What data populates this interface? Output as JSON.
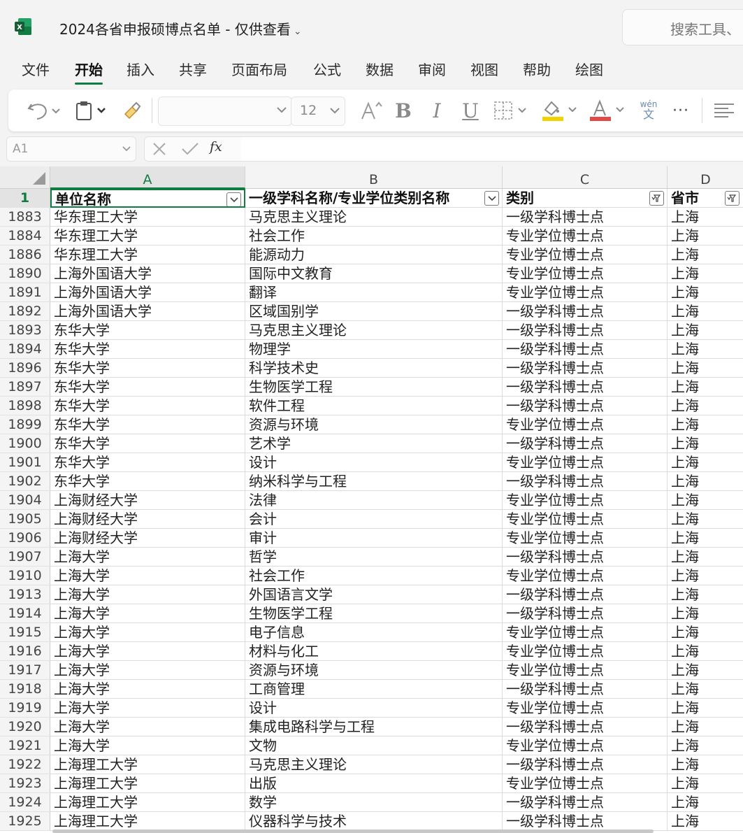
{
  "app": {
    "title": "2024各省申报硕博点名单 - 仅供查看",
    "title_chevron": "⌄",
    "search_placeholder": "搜索工具、"
  },
  "tabs": [
    "文件",
    "开始",
    "插入",
    "共享",
    "页面布局",
    "公式",
    "数据",
    "审阅",
    "视图",
    "帮助",
    "绘图"
  ],
  "active_tab": "开始",
  "ribbon": {
    "font_name": "",
    "font_size": "12",
    "wen_label": "wén",
    "wen_char": "文",
    "more_label": "···"
  },
  "formula_bar": {
    "name_box": "A1",
    "fx_label": "fx",
    "formula": ""
  },
  "sheet": {
    "columns": [
      "A",
      "B",
      "C",
      "D"
    ],
    "header_row": {
      "row_number": "1",
      "cells": [
        "单位名称",
        "一级学科名称/专业学位类别名称",
        "类别",
        "省市"
      ]
    },
    "rows": [
      {
        "n": "1883",
        "c": [
          "华东理工大学",
          "马克思主义理论",
          "一级学科博士点",
          "上海"
        ]
      },
      {
        "n": "1884",
        "c": [
          "华东理工大学",
          "社会工作",
          "专业学位博士点",
          "上海"
        ]
      },
      {
        "n": "1886",
        "c": [
          "华东理工大学",
          "能源动力",
          "专业学位博士点",
          "上海"
        ]
      },
      {
        "n": "1890",
        "c": [
          "上海外国语大学",
          "国际中文教育",
          "专业学位博士点",
          "上海"
        ]
      },
      {
        "n": "1891",
        "c": [
          "上海外国语大学",
          "翻译",
          "专业学位博士点",
          "上海"
        ]
      },
      {
        "n": "1892",
        "c": [
          "上海外国语大学",
          "区域国别学",
          "一级学科博士点",
          "上海"
        ]
      },
      {
        "n": "1893",
        "c": [
          "东华大学",
          "马克思主义理论",
          "一级学科博士点",
          "上海"
        ]
      },
      {
        "n": "1894",
        "c": [
          "东华大学",
          "物理学",
          "一级学科博士点",
          "上海"
        ]
      },
      {
        "n": "1896",
        "c": [
          "东华大学",
          "科学技术史",
          "一级学科博士点",
          "上海"
        ]
      },
      {
        "n": "1897",
        "c": [
          "东华大学",
          "生物医学工程",
          "一级学科博士点",
          "上海"
        ]
      },
      {
        "n": "1898",
        "c": [
          "东华大学",
          "软件工程",
          "一级学科博士点",
          "上海"
        ]
      },
      {
        "n": "1899",
        "c": [
          "东华大学",
          "资源与环境",
          "专业学位博士点",
          "上海"
        ]
      },
      {
        "n": "1900",
        "c": [
          "东华大学",
          "艺术学",
          "一级学科博士点",
          "上海"
        ]
      },
      {
        "n": "1901",
        "c": [
          "东华大学",
          "设计",
          "专业学位博士点",
          "上海"
        ]
      },
      {
        "n": "1902",
        "c": [
          "东华大学",
          "纳米科学与工程",
          "一级学科博士点",
          "上海"
        ]
      },
      {
        "n": "1904",
        "c": [
          "上海财经大学",
          "法律",
          "专业学位博士点",
          "上海"
        ]
      },
      {
        "n": "1905",
        "c": [
          "上海财经大学",
          "会计",
          "专业学位博士点",
          "上海"
        ]
      },
      {
        "n": "1906",
        "c": [
          "上海财经大学",
          "审计",
          "专业学位博士点",
          "上海"
        ]
      },
      {
        "n": "1907",
        "c": [
          "上海大学",
          "哲学",
          "一级学科博士点",
          "上海"
        ]
      },
      {
        "n": "1910",
        "c": [
          "上海大学",
          "社会工作",
          "专业学位博士点",
          "上海"
        ]
      },
      {
        "n": "1913",
        "c": [
          "上海大学",
          "外国语言文学",
          "一级学科博士点",
          "上海"
        ]
      },
      {
        "n": "1914",
        "c": [
          "上海大学",
          "生物医学工程",
          "一级学科博士点",
          "上海"
        ]
      },
      {
        "n": "1915",
        "c": [
          "上海大学",
          "电子信息",
          "专业学位博士点",
          "上海"
        ]
      },
      {
        "n": "1916",
        "c": [
          "上海大学",
          "材料与化工",
          "专业学位博士点",
          "上海"
        ]
      },
      {
        "n": "1917",
        "c": [
          "上海大学",
          "资源与环境",
          "专业学位博士点",
          "上海"
        ]
      },
      {
        "n": "1918",
        "c": [
          "上海大学",
          "工商管理",
          "一级学科博士点",
          "上海"
        ]
      },
      {
        "n": "1919",
        "c": [
          "上海大学",
          "设计",
          "专业学位博士点",
          "上海"
        ]
      },
      {
        "n": "1920",
        "c": [
          "上海大学",
          "集成电路科学与工程",
          "一级学科博士点",
          "上海"
        ]
      },
      {
        "n": "1921",
        "c": [
          "上海大学",
          "文物",
          "专业学位博士点",
          "上海"
        ]
      },
      {
        "n": "1922",
        "c": [
          "上海理工大学",
          "马克思主义理论",
          "一级学科博士点",
          "上海"
        ]
      },
      {
        "n": "1923",
        "c": [
          "上海理工大学",
          "出版",
          "专业学位博士点",
          "上海"
        ]
      },
      {
        "n": "1924",
        "c": [
          "上海理工大学",
          "数学",
          "一级学科博士点",
          "上海"
        ]
      },
      {
        "n": "1925",
        "c": [
          "上海理工大学",
          "仪器科学与技术",
          "一级学科博士点",
          "上海"
        ]
      }
    ]
  },
  "colors": {
    "accent": "#107c41",
    "highlight_yellow": "#f2d200",
    "font_color_red": "#e24a4a"
  }
}
